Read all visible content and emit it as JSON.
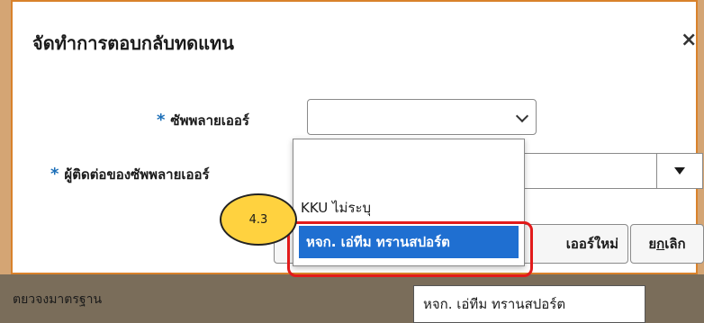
{
  "dialog": {
    "title": "จัดทำการตอบกลับทดแทน",
    "close_symbol": "×"
  },
  "form": {
    "required_marker": "*",
    "supplier_label": "ซัพพลายเออร์",
    "supplier_value": "",
    "contact_label": "ผู้ติดต่อของซัพพลายเออร์",
    "contact_value": ""
  },
  "buttons": {
    "new_supplier_label": "เออร์ใหม่",
    "cancel_prefix": "ย",
    "cancel_underlined": "ก",
    "cancel_suffix": "เลิก"
  },
  "dropdown": {
    "options": [
      {
        "label": ""
      },
      {
        "label": "KKU ไม่ระบุ"
      },
      {
        "label": "หจก. เอ่ทีม ทรานสปอร์ต",
        "selected": true
      }
    ]
  },
  "annotation": {
    "step": "4.3"
  },
  "tooltip": {
    "text": "หจก. เอ่ทีม ทรานสปอร์ต"
  },
  "background": {
    "partial_text": "ตยวจงมาตรฐาน"
  },
  "colors": {
    "accent_border": "#d9822b",
    "required_star": "#1c6fb8",
    "selection": "#1f6fd1",
    "highlight": "#e21b1b",
    "badge": "#ffd23f"
  }
}
